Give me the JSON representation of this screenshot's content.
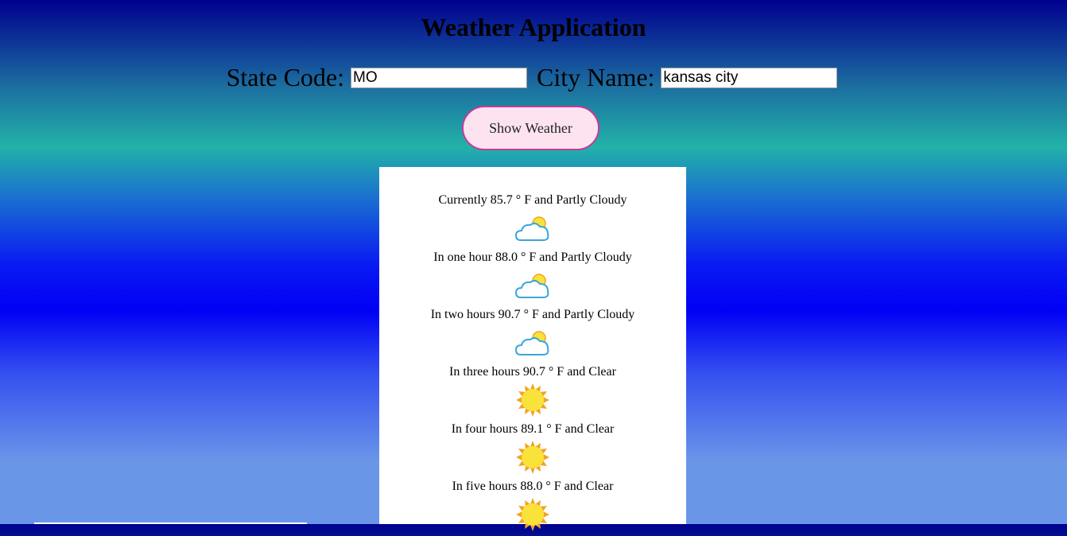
{
  "page": {
    "title": "Weather Application"
  },
  "form": {
    "state_label": "State Code:",
    "state_value": "MO",
    "city_label": "City Name:",
    "city_value": "kansas city",
    "button_label": "Show Weather"
  },
  "forecast": [
    {
      "text": "Currently 85.7 ° F and Partly Cloudy",
      "icon": "partly-cloudy-icon"
    },
    {
      "text": "In one hour 88.0 ° F and Partly Cloudy",
      "icon": "partly-cloudy-icon"
    },
    {
      "text": "In two hours 90.7 ° F and Partly Cloudy",
      "icon": "partly-cloudy-icon"
    },
    {
      "text": "In three hours 90.7 ° F and Clear",
      "icon": "sun-icon"
    },
    {
      "text": "In four hours 89.1 ° F and Clear",
      "icon": "sun-icon"
    },
    {
      "text": "In five hours 88.0 ° F and Clear",
      "icon": "sun-icon"
    }
  ],
  "colors": {
    "button_bg": "#fde3ef",
    "button_border": "#c8389a",
    "sun": "#f9e23a",
    "sun_edge": "#f2a323",
    "cloud_stroke": "#3aa6d8"
  }
}
